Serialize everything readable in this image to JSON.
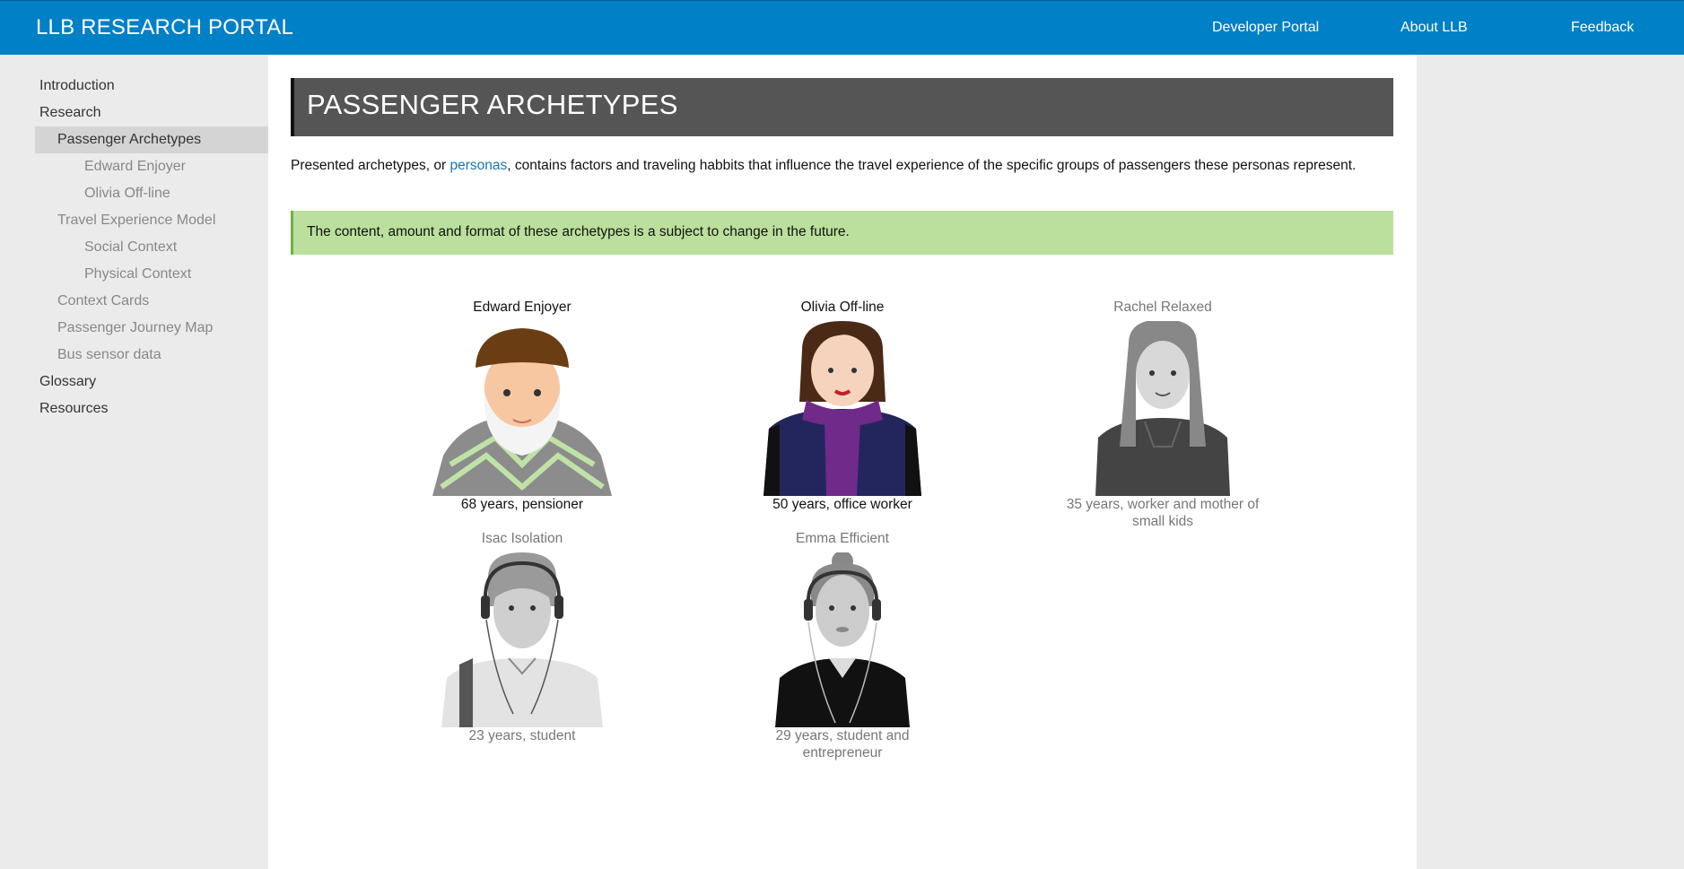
{
  "header": {
    "brand": "LLB RESEARCH PORTAL",
    "nav": [
      "Developer Portal",
      "About LLB",
      "Feedback"
    ]
  },
  "sidebar": {
    "items": [
      {
        "label": "Introduction"
      },
      {
        "label": "Research"
      },
      {
        "label": "Passenger Archetypes"
      },
      {
        "label": "Edward Enjoyer"
      },
      {
        "label": "Olivia Off-line"
      },
      {
        "label": "Travel Experience Model"
      },
      {
        "label": "Social Context"
      },
      {
        "label": "Physical Context"
      },
      {
        "label": "Context Cards"
      },
      {
        "label": "Passenger Journey Map"
      },
      {
        "label": "Bus sensor data"
      },
      {
        "label": "Glossary"
      },
      {
        "label": "Resources"
      }
    ]
  },
  "main": {
    "title": "PASSENGER ARCHETYPES",
    "intro_before": "Presented archetypes, or ",
    "intro_link": "personas",
    "intro_after": ", contains factors and traveling habbits that influence the travel experience of the specific groups of passengers these personas represent.",
    "note": "The content, amount and format of these archetypes is a subject to change in the future.",
    "personas": [
      {
        "name": "Edward Enjoyer",
        "desc": "68 years, pensioner"
      },
      {
        "name": "Olivia Off-line",
        "desc": "50 years, office worker"
      },
      {
        "name": "Rachel Relaxed",
        "desc": "35 years, worker and mother of small kids"
      },
      {
        "name": "Isac Isolation",
        "desc": "23 years, student"
      },
      {
        "name": "Emma Efficient",
        "desc": "29 years, student and entrepreneur"
      }
    ]
  },
  "colors": {
    "header_bg": "#0080c6",
    "title_bg": "#555555",
    "note_bg": "#bbe09d",
    "link": "#1a73b5",
    "sidebar_active": "#d4d4d4"
  }
}
